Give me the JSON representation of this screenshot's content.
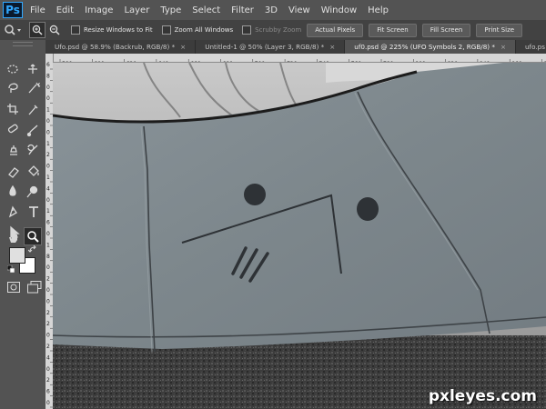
{
  "app": {
    "logo": "Ps"
  },
  "menu": [
    "File",
    "Edit",
    "Image",
    "Layer",
    "Type",
    "Select",
    "Filter",
    "3D",
    "View",
    "Window",
    "Help"
  ],
  "options": {
    "tool_icon": "zoom-icon",
    "zoom_in_symbol": "+",
    "zoom_out_symbol": "−",
    "resize_windows_label": "Resize Windows to Fit",
    "zoom_all_label": "Zoom All Windows",
    "scrubby_zoom_label": "Scrubby Zoom",
    "actual_pixels": "Actual Pixels",
    "fit_screen": "Fit Screen",
    "fill_screen": "Fill Screen",
    "print_size": "Print Size"
  },
  "tabs": [
    {
      "label": "Ufo.psd @ 58.9% (Backrub, RGB/8) *",
      "close": "×"
    },
    {
      "label": "Untitled-1 @ 50% (Layer 3, RGB/8) *",
      "close": "×"
    },
    {
      "label": "uf0.psd @ 225% (UFO Symbols 2, RGB/8) *",
      "close": "×"
    },
    {
      "label": "ufo.ps"
    }
  ],
  "ruler_top": [
    "580",
    "600",
    "620",
    "640",
    "660",
    "680",
    "700",
    "720",
    "740",
    "760",
    "780",
    "800",
    "820",
    "840",
    "860",
    "880"
  ],
  "ruler_left": [
    "6",
    "8",
    "0",
    "0",
    "1",
    "0",
    "0",
    "1",
    "2",
    "0",
    "1",
    "4",
    "0",
    "1",
    "6",
    "0",
    "1",
    "8",
    "0",
    "2",
    "0",
    "0",
    "2",
    "2",
    "0",
    "2",
    "4",
    "0",
    "2",
    "6",
    "0"
  ],
  "watermark": "pxleyes.com",
  "colors": {
    "menubar": "#535353",
    "panel": "#424242",
    "canvas_gray": "#7f868a",
    "accent": "#31a8ff"
  }
}
